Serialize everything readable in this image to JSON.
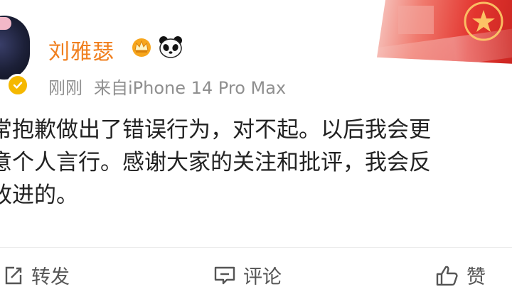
{
  "post": {
    "username": "刘雅瑟",
    "time": "刚刚",
    "source": "来自iPhone 14 Pro Max",
    "content_lines": [
      "常抱歉做出了错误行为，对不起。以后我会更",
      "意个人言行。感谢大家的关注和批评，我会反",
      "改进的。"
    ]
  },
  "actions": {
    "repost": "转发",
    "comment": "评论",
    "like": "赞"
  },
  "colors": {
    "username": "#f07f1e",
    "verified": "#f5b800",
    "meta": "#8f8f8f"
  },
  "icons": [
    "avatar",
    "verified-badge-icon",
    "vip-crown-icon",
    "panda-icon",
    "repost-icon",
    "comment-icon",
    "like-icon"
  ]
}
